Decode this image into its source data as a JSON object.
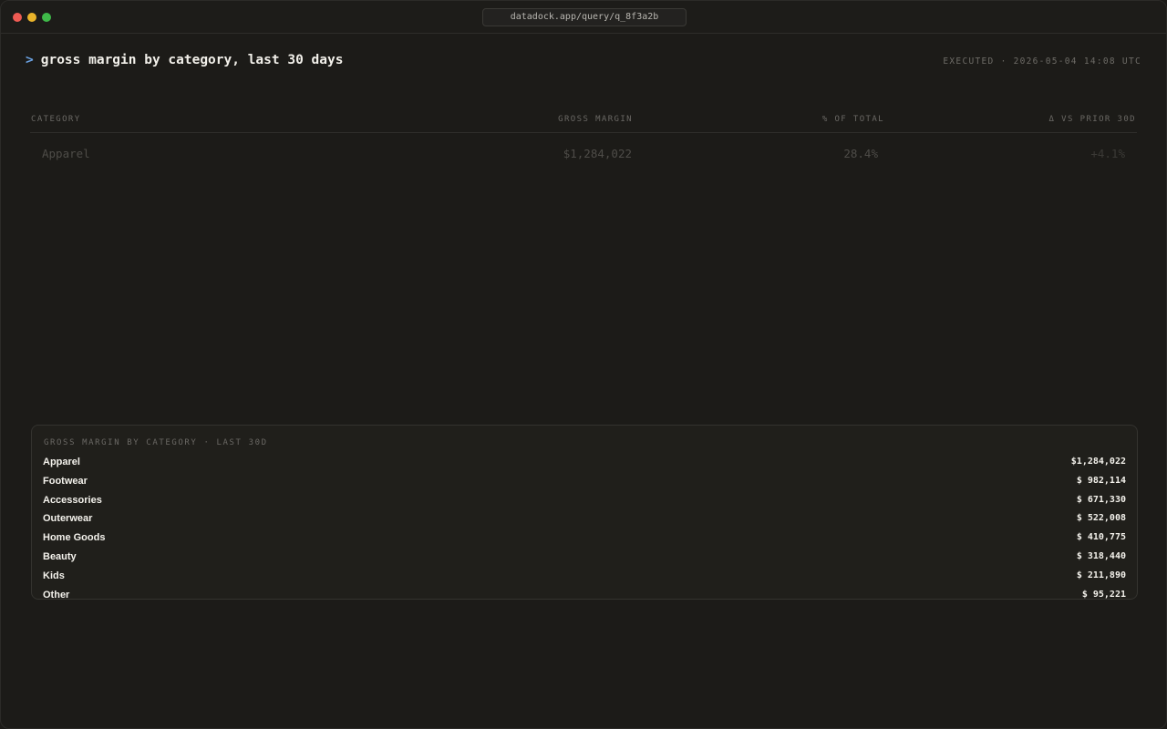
{
  "url": "datadock.app/query/q_8f3a2b",
  "query": {
    "caret": ">",
    "text": "gross margin by category, last 30 days",
    "executed": "EXECUTED · 2026-05-04 14:08 UTC"
  },
  "table": {
    "headers": [
      "CATEGORY",
      "GROSS MARGIN",
      "% OF TOTAL",
      "Δ VS PRIOR 30D"
    ],
    "rows": [
      {
        "category": "Apparel",
        "gross_margin": "$1,284,022",
        "pct_total": "28.4%",
        "delta": "+4.1%"
      }
    ]
  },
  "panel": {
    "title": "GROSS MARGIN BY CATEGORY · LAST 30D",
    "items": [
      {
        "label": "Apparel",
        "value": "$1,284,022"
      },
      {
        "label": "Footwear",
        "value": "$ 982,114"
      },
      {
        "label": "Accessories",
        "value": "$ 671,330"
      },
      {
        "label": "Outerwear",
        "value": "$ 522,008"
      },
      {
        "label": "Home Goods",
        "value": "$ 410,775"
      },
      {
        "label": "Beauty",
        "value": "$ 318,440"
      },
      {
        "label": "Kids",
        "value": "$ 211,890"
      },
      {
        "label": "Other",
        "value": "$ 95,221"
      }
    ]
  },
  "colors": {
    "background": "#1c1b18",
    "accent_caret": "#6aa0e0",
    "window_red": "#ee5b53",
    "window_yellow": "#e9b32a",
    "window_green": "#3fb949"
  }
}
